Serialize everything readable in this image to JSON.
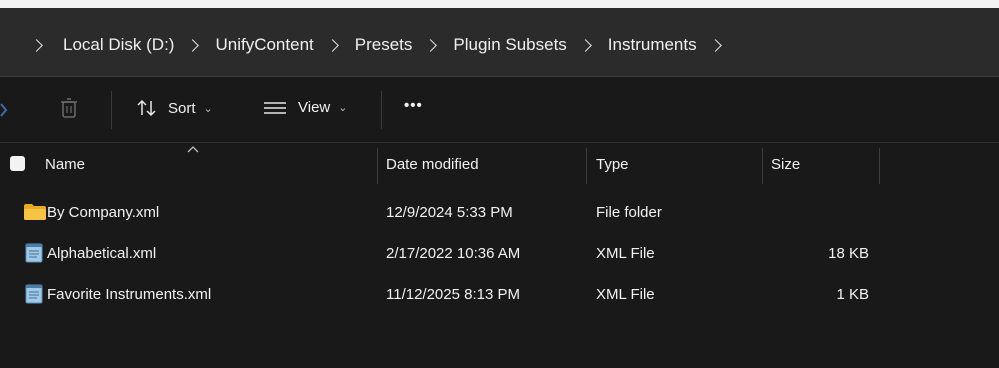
{
  "breadcrumb": [
    "Local Disk (D:)",
    "UnifyContent",
    "Presets",
    "Plugin Subsets",
    "Instruments"
  ],
  "toolbar": {
    "sort_label": "Sort",
    "view_label": "View",
    "more_label": "•••"
  },
  "columns": {
    "name": "Name",
    "date": "Date modified",
    "type": "Type",
    "size": "Size"
  },
  "files": [
    {
      "name": "By Company.xml",
      "date": "12/9/2024 5:33 PM",
      "type": "File folder",
      "size": "",
      "icon": "folder-icon"
    },
    {
      "name": "Alphabetical.xml",
      "date": "2/17/2022 10:36 AM",
      "type": "XML File",
      "size": "18 KB",
      "icon": "notepad-file-icon"
    },
    {
      "name": "Favorite Instruments.xml",
      "date": "11/12/2025 8:13 PM",
      "type": "XML File",
      "size": "1 KB",
      "icon": "notepad-file-icon"
    }
  ],
  "colors": {
    "background": "#191919",
    "address_bar": "#2b2b2b",
    "text": "#f2f2f2",
    "folder": "#f6c344"
  }
}
